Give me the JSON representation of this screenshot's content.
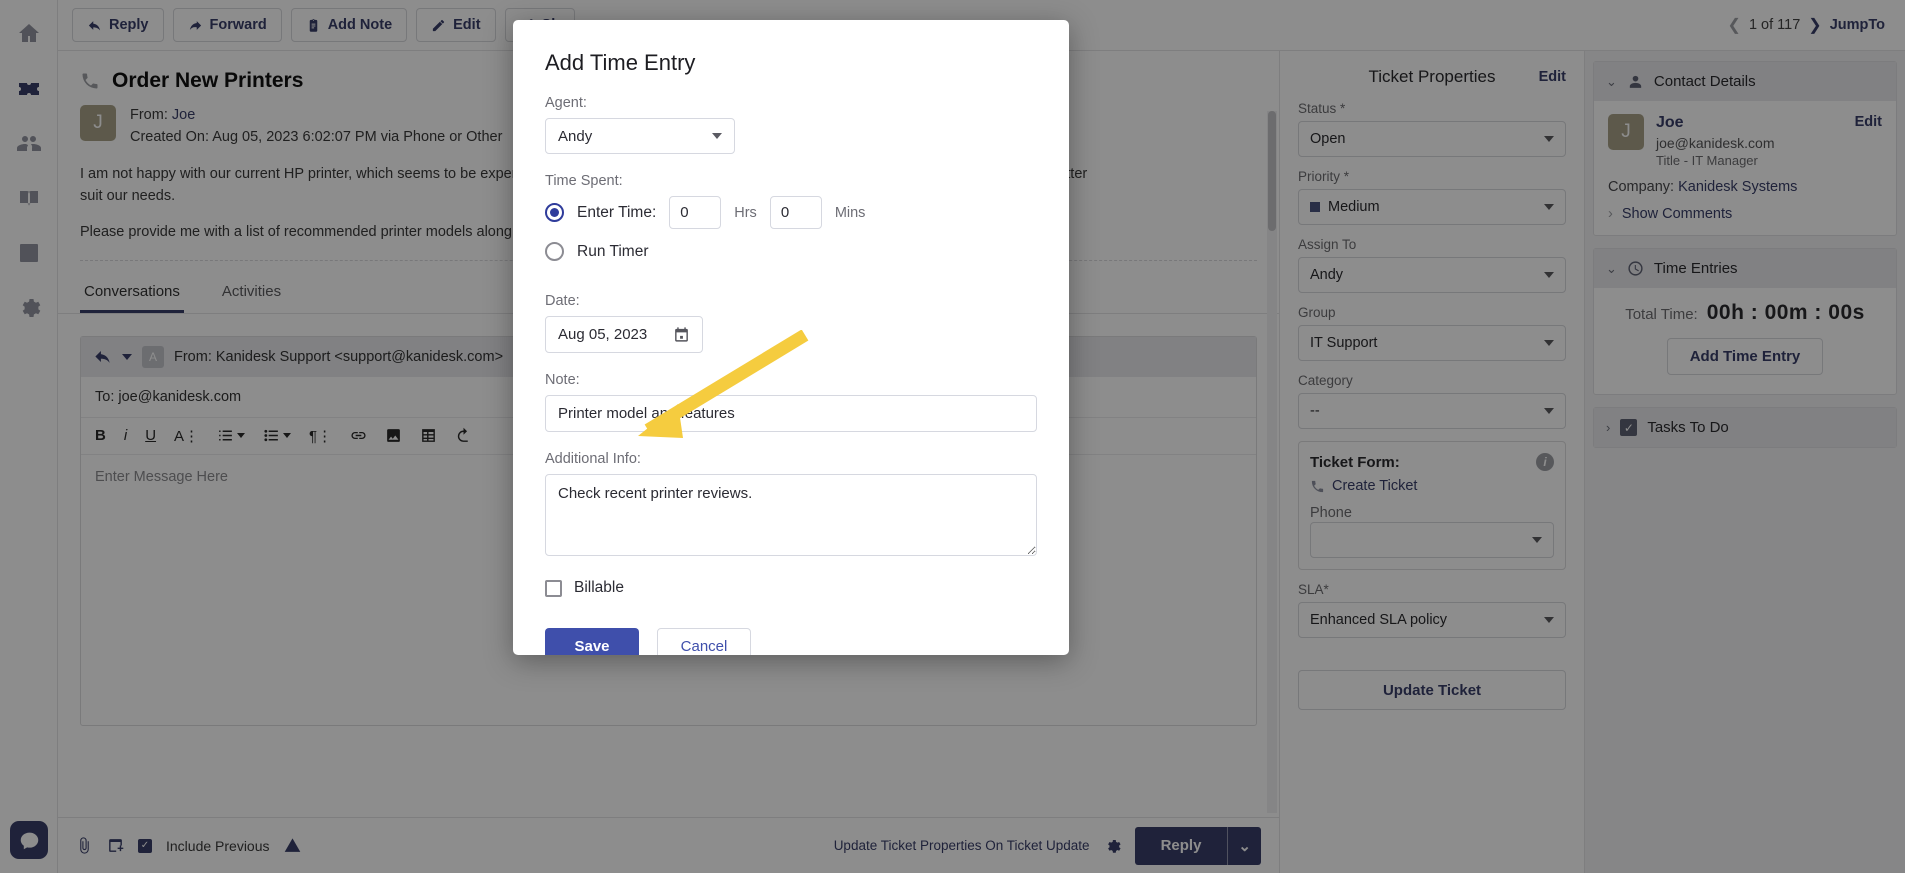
{
  "rail": {
    "items": [
      {
        "name": "home-icon",
        "label": "Home"
      },
      {
        "name": "ticket-icon",
        "label": "Tickets"
      },
      {
        "name": "contacts-icon",
        "label": "Contacts"
      },
      {
        "name": "knowledge-base-icon",
        "label": "Knowledge Base"
      },
      {
        "name": "reports-icon",
        "label": "Reports"
      },
      {
        "name": "gear-icon",
        "label": "Settings"
      }
    ],
    "support_chat_label": "Support Chat"
  },
  "toolbar": {
    "reply": "Reply",
    "forward": "Forward",
    "add_note": "Add Note",
    "edit": "Edit",
    "share": "Sh",
    "pager": "1 of 117",
    "jump_to": "JumpTo"
  },
  "ticket": {
    "title": "Order New Printers",
    "from_label": "From:",
    "from_name": "Joe",
    "created_on": "Created On: Aug 05, 2023 6:02:07 PM via Phone or Other",
    "avatar_initial": "J",
    "body_p1": "I am not happy with our current HP printer, which seems to be experiencing frequent issues. I would like to explore alternative printer options that could better suit our needs.",
    "body_p2": "Please provide me with a list of recommended printer models along with their pricing."
  },
  "tabs": [
    {
      "label": "Conversations",
      "active": true
    },
    {
      "label": "Activities",
      "active": false
    }
  ],
  "composer": {
    "from": "From:  Kanidesk Support <support@kanidesk.com>",
    "avatar_initial": "A",
    "to": "To: joe@kanidesk.com",
    "placeholder": "Enter Message Here",
    "format_buttons": [
      {
        "name": "bold-icon",
        "label": "B"
      },
      {
        "name": "italic-icon",
        "label": "i"
      },
      {
        "name": "underline-icon",
        "label": "U"
      },
      {
        "name": "font-style-icon",
        "label": "A"
      },
      {
        "name": "numbered-list-icon",
        "label": "list"
      },
      {
        "name": "bullet-list-icon",
        "label": "list"
      },
      {
        "name": "paragraph-icon",
        "label": "paragraph"
      },
      {
        "name": "link-icon",
        "label": "link"
      },
      {
        "name": "image-icon",
        "label": "image"
      },
      {
        "name": "table-icon",
        "label": "table"
      },
      {
        "name": "undo-icon",
        "label": "undo"
      }
    ]
  },
  "bottombar": {
    "include_previous": "Include Previous",
    "update_link": "Update Ticket Properties On Ticket Update",
    "reply": "Reply"
  },
  "properties": {
    "heading": "Ticket Properties",
    "edit": "Edit",
    "fields": [
      {
        "label": "Status *",
        "value": "Open",
        "swatch": null
      },
      {
        "label": "Priority *",
        "value": "Medium",
        "swatch": "#3f51b5"
      },
      {
        "label": "Assign To",
        "value": "Andy",
        "swatch": null
      },
      {
        "label": "Group",
        "value": "IT Support",
        "swatch": null
      },
      {
        "label": "Category",
        "value": "--",
        "swatch": null
      }
    ],
    "form_heading": "Ticket Form:",
    "form_name": "Create Ticket",
    "phone_label": "Phone",
    "phone_value": "",
    "sla_label": "SLA*",
    "sla_value": "Enhanced SLA policy",
    "update_button": "Update Ticket"
  },
  "contact": {
    "heading": "Contact Details",
    "avatar_initial": "J",
    "name": "Joe",
    "edit": "Edit",
    "email": "joe@kanidesk.com",
    "title": "Title - IT Manager",
    "company_label": "Company:",
    "company": "Kanidesk Systems",
    "show_comments": "Show Comments"
  },
  "time_entries": {
    "heading": "Time Entries",
    "total_label": "Total Time:",
    "total_value": "00h : 00m : 00s",
    "add_button": "Add Time Entry"
  },
  "tasks": {
    "heading": "Tasks To Do"
  },
  "dialog": {
    "title": "Add Time Entry",
    "agent_label": "Agent:",
    "agent_value": "Andy",
    "time_spent_label": "Time Spent:",
    "enter_time_label": "Enter Time:",
    "hours_value": "0",
    "hours_unit": "Hrs",
    "minutes_value": "0",
    "minutes_unit": "Mins",
    "run_timer_label": "Run Timer",
    "date_label": "Date:",
    "date_value": "Aug 05, 2023",
    "note_label": "Note:",
    "note_value": "Printer model and features",
    "additional_label": "Additional Info:",
    "additional_value": "Check recent printer reviews.",
    "billable_label": "Billable",
    "save": "Save",
    "cancel": "Cancel"
  },
  "annotation": {
    "arrow_color": "#f5cc3f",
    "points_at": "Additional Info:"
  }
}
